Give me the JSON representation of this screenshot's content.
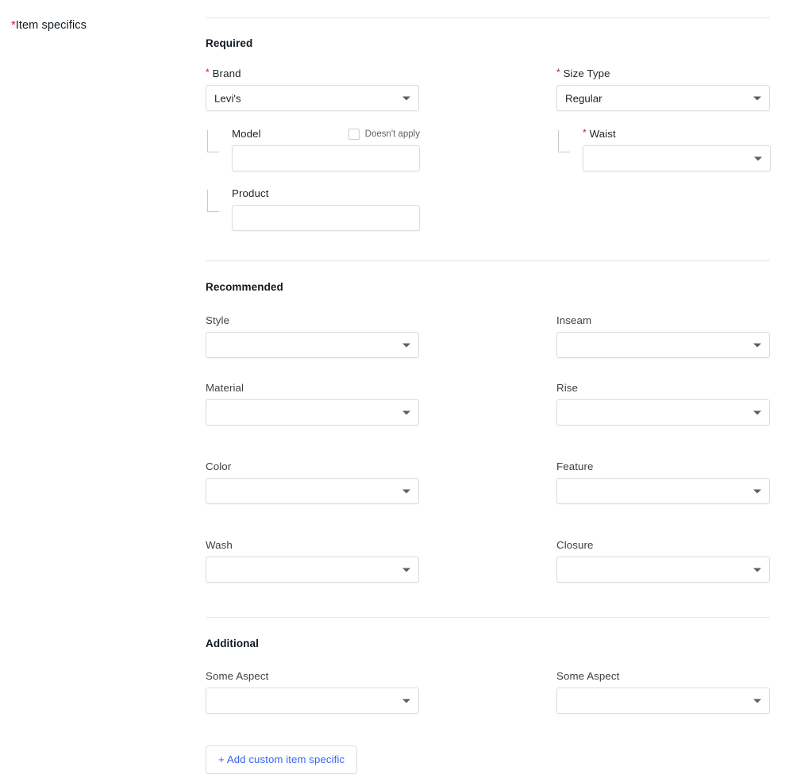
{
  "gutter": {
    "label": "Item specifics",
    "required_marker": "*"
  },
  "sections": {
    "required": {
      "title": "Required",
      "fields": {
        "brand": {
          "label": "Brand",
          "required_marker": "*",
          "value": "Levi's",
          "type": "select",
          "indent": false
        },
        "size_type": {
          "label": "Size Type",
          "required_marker": "*",
          "value": "Regular",
          "type": "select",
          "indent": false
        },
        "model": {
          "label": "Model",
          "value": "",
          "type": "text",
          "indent": true,
          "checkbox": {
            "label": "Doesn't apply",
            "checked": false
          }
        },
        "waist": {
          "label": "Waist",
          "required_marker": "*",
          "value": "",
          "type": "select",
          "indent": true
        },
        "product": {
          "label": "Product",
          "value": "",
          "type": "text",
          "indent": true
        }
      }
    },
    "recommended": {
      "title": "Recommended",
      "fields": {
        "style": {
          "label": "Style",
          "value": "",
          "type": "select"
        },
        "inseam": {
          "label": "Inseam",
          "value": "",
          "type": "select"
        },
        "material": {
          "label": "Material",
          "value": "",
          "type": "select"
        },
        "rise": {
          "label": "Rise",
          "value": "",
          "type": "select"
        },
        "color": {
          "label": "Color",
          "value": "",
          "type": "select"
        },
        "feature": {
          "label": "Feature",
          "value": "",
          "type": "select"
        },
        "wash": {
          "label": "Wash",
          "value": "",
          "type": "select"
        },
        "closure": {
          "label": "Closure",
          "value": "",
          "type": "select"
        }
      }
    },
    "additional": {
      "title": "Additional",
      "fields": {
        "aspect_left": {
          "label": "Some Aspect",
          "value": "",
          "type": "select"
        },
        "aspect_right": {
          "label": "Some Aspect",
          "value": "",
          "type": "select"
        }
      },
      "add_button": {
        "label": "+ Add custom item specific"
      }
    }
  },
  "colors": {
    "required_star": "#c7133e",
    "link_blue": "#3665f3",
    "border": "#dadcde",
    "divider": "#e5e5e5",
    "label_text": "#3b3f42"
  }
}
